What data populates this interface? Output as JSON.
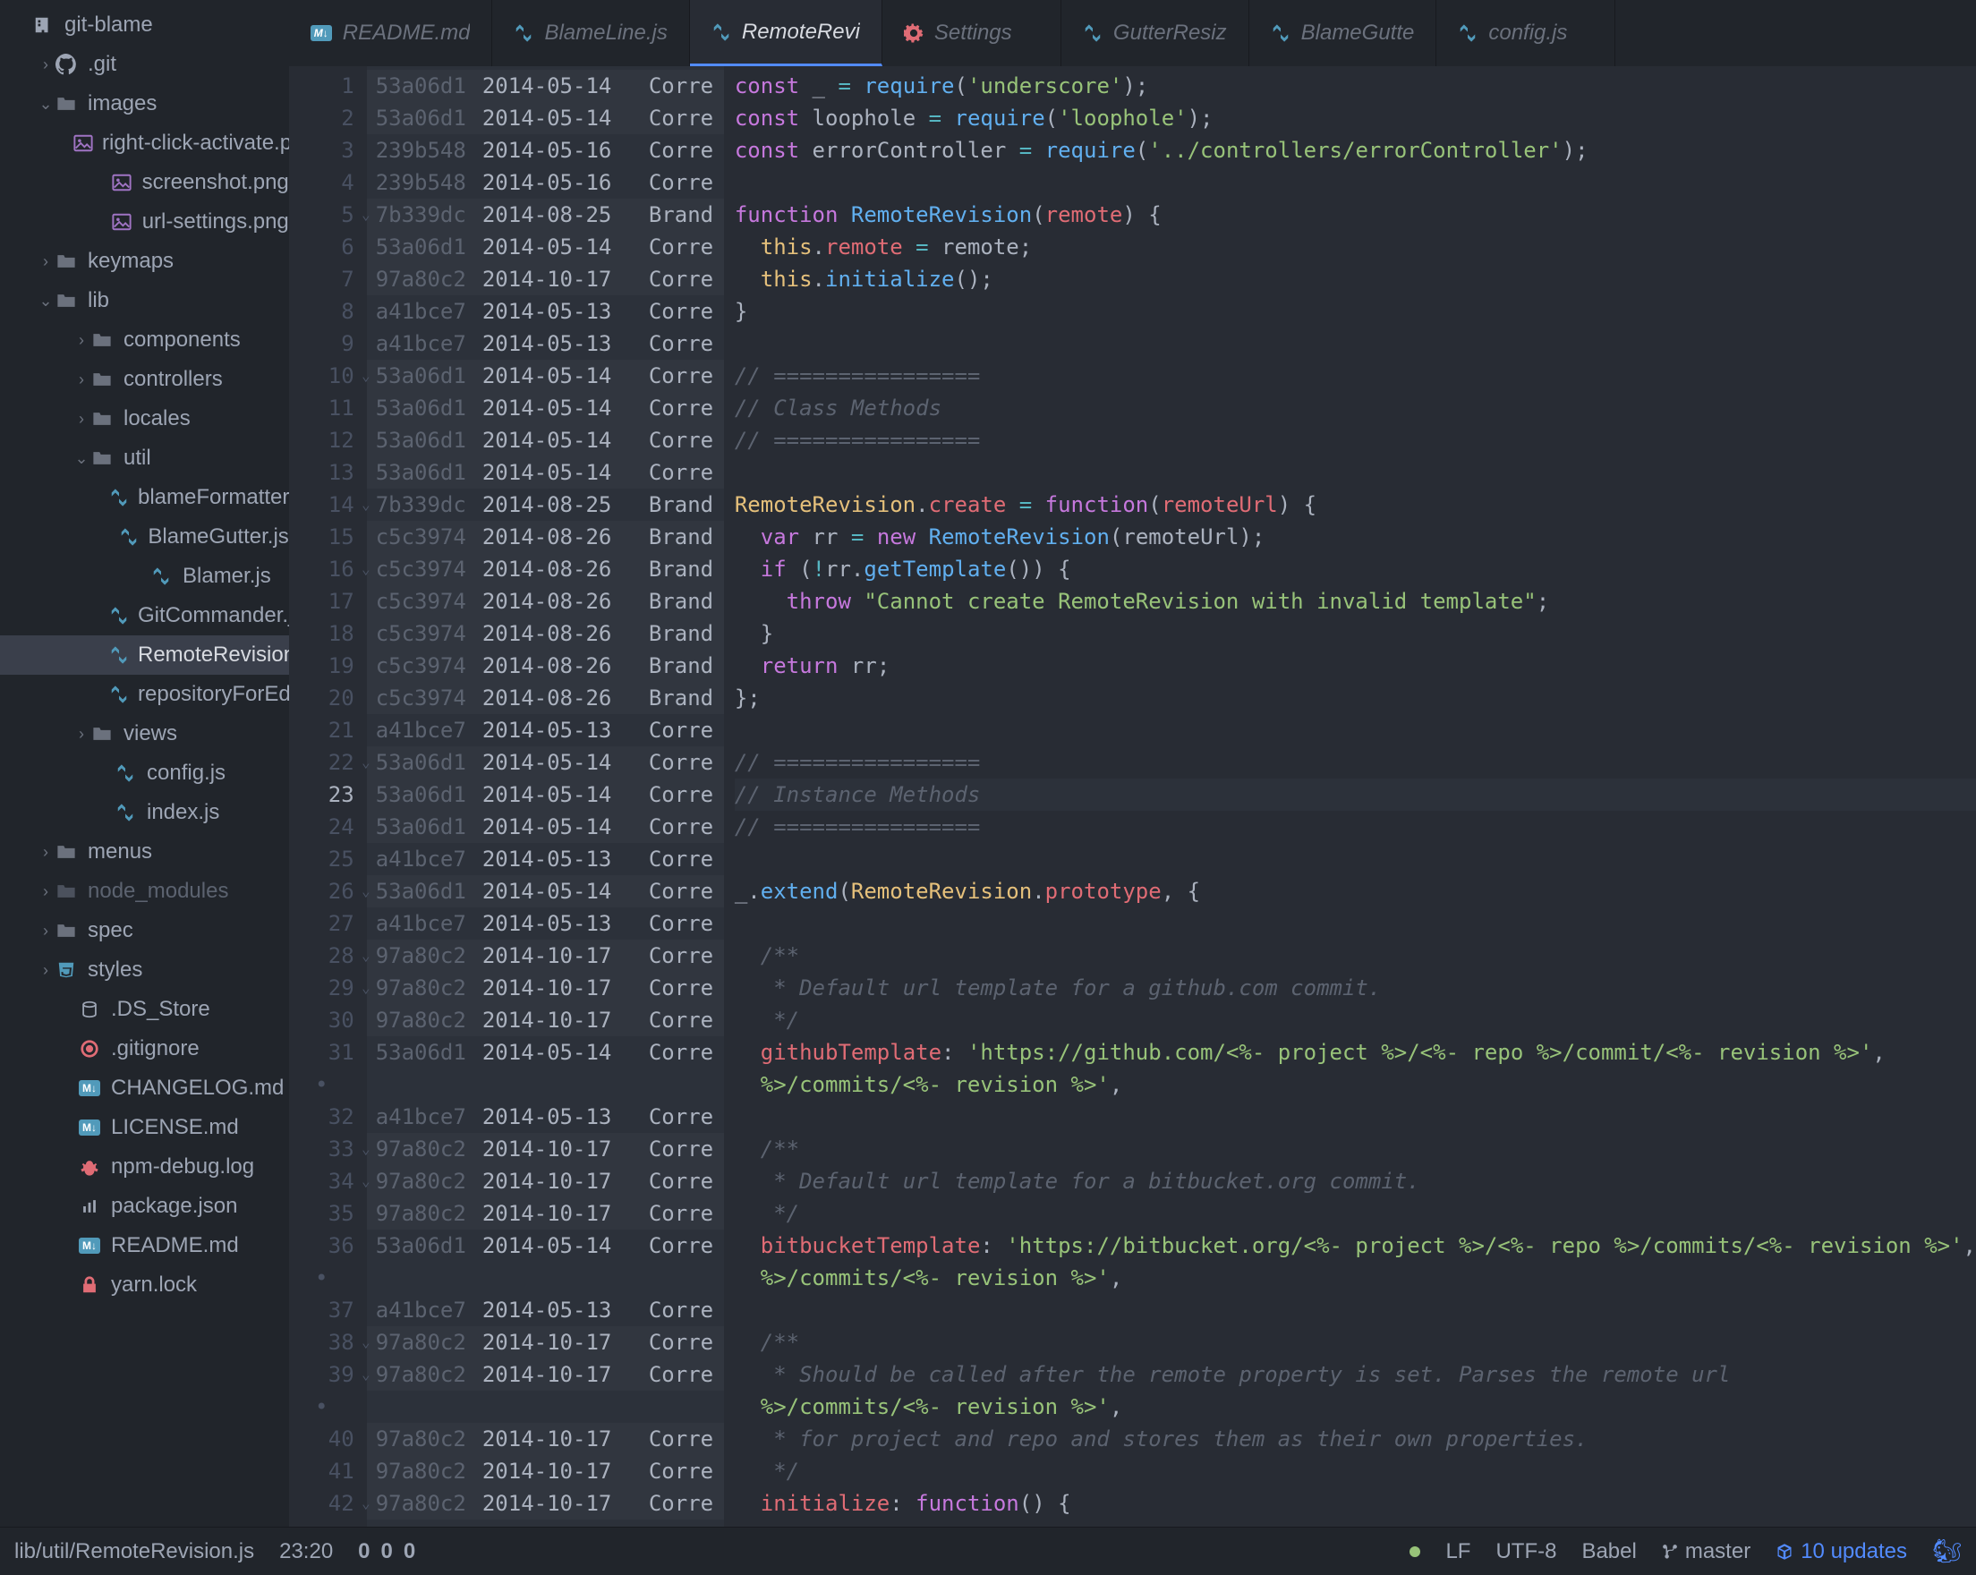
{
  "project": {
    "name": "git-blame"
  },
  "tree": [
    {
      "indent": 0,
      "chev": "",
      "iconType": "repo",
      "label": "git-blame"
    },
    {
      "indent": 1,
      "chev": "›",
      "iconType": "github",
      "label": ".git"
    },
    {
      "indent": 1,
      "chev": "⌄",
      "iconType": "folder",
      "label": "images"
    },
    {
      "indent": 2,
      "chev": "",
      "iconType": "img",
      "label": "right-click-activate.png",
      "leaf": true
    },
    {
      "indent": 2,
      "chev": "",
      "iconType": "img",
      "label": "screenshot.png",
      "leaf": true
    },
    {
      "indent": 2,
      "chev": "",
      "iconType": "img",
      "label": "url-settings.png",
      "leaf": true
    },
    {
      "indent": 1,
      "chev": "›",
      "iconType": "folder",
      "label": "keymaps"
    },
    {
      "indent": 1,
      "chev": "⌄",
      "iconType": "folder",
      "label": "lib"
    },
    {
      "indent": 2,
      "chev": "›",
      "iconType": "folder",
      "label": "components"
    },
    {
      "indent": 2,
      "chev": "›",
      "iconType": "folder",
      "label": "controllers"
    },
    {
      "indent": 2,
      "chev": "›",
      "iconType": "folder",
      "label": "locales"
    },
    {
      "indent": 2,
      "chev": "⌄",
      "iconType": "folder",
      "label": "util"
    },
    {
      "indent": 3,
      "chev": "",
      "iconType": "js",
      "label": "blameFormatter.js",
      "leaf": true
    },
    {
      "indent": 3,
      "chev": "",
      "iconType": "js",
      "label": "BlameGutter.js",
      "leaf": true
    },
    {
      "indent": 3,
      "chev": "",
      "iconType": "js",
      "label": "Blamer.js",
      "leaf": true
    },
    {
      "indent": 3,
      "chev": "",
      "iconType": "js",
      "label": "GitCommander.js",
      "leaf": true
    },
    {
      "indent": 3,
      "chev": "",
      "iconType": "js",
      "label": "RemoteRevision.js",
      "leaf": true,
      "selected": true
    },
    {
      "indent": 3,
      "chev": "",
      "iconType": "js",
      "label": "repositoryForEditorPath.js",
      "leaf": true
    },
    {
      "indent": 2,
      "chev": "›",
      "iconType": "folder",
      "label": "views"
    },
    {
      "indent": 2,
      "chev": "",
      "iconType": "js",
      "label": "config.js",
      "leaf": true
    },
    {
      "indent": 2,
      "chev": "",
      "iconType": "js",
      "label": "index.js",
      "leaf": true
    },
    {
      "indent": 1,
      "chev": "›",
      "iconType": "folder",
      "label": "menus"
    },
    {
      "indent": 1,
      "chev": "›",
      "iconType": "folder-dim",
      "label": "node_modules"
    },
    {
      "indent": 1,
      "chev": "›",
      "iconType": "folder",
      "label": "spec"
    },
    {
      "indent": 1,
      "chev": "›",
      "iconType": "css",
      "label": "styles"
    },
    {
      "indent": 1,
      "chev": "",
      "iconType": "data",
      "label": ".DS_Store",
      "leaf": true
    },
    {
      "indent": 1,
      "chev": "",
      "iconType": "git",
      "label": ".gitignore",
      "leaf": true
    },
    {
      "indent": 1,
      "chev": "",
      "iconType": "md",
      "label": "CHANGELOG.md",
      "leaf": true
    },
    {
      "indent": 1,
      "chev": "",
      "iconType": "md",
      "label": "LICENSE.md",
      "leaf": true
    },
    {
      "indent": 1,
      "chev": "",
      "iconType": "bug",
      "label": "npm-debug.log",
      "leaf": true
    },
    {
      "indent": 1,
      "chev": "",
      "iconType": "npm",
      "label": "package.json",
      "leaf": true
    },
    {
      "indent": 1,
      "chev": "",
      "iconType": "md",
      "label": "README.md",
      "leaf": true
    },
    {
      "indent": 1,
      "chev": "",
      "iconType": "lock",
      "label": "yarn.lock",
      "leaf": true
    }
  ],
  "tabs": [
    {
      "icon": "md",
      "label": "README.md"
    },
    {
      "icon": "js",
      "label": "BlameLine.js"
    },
    {
      "icon": "js",
      "label": "RemoteRevi",
      "active": true
    },
    {
      "icon": "gear",
      "label": "Settings"
    },
    {
      "icon": "js",
      "label": "GutterResiz"
    },
    {
      "icon": "js",
      "label": "BlameGutte"
    },
    {
      "icon": "js",
      "label": "config.js"
    }
  ],
  "blame": [
    {
      "n": 1,
      "hash": "53a06d1",
      "date": "2014-05-14",
      "auth": "Corre",
      "alt": true
    },
    {
      "n": 2,
      "hash": "53a06d1",
      "date": "2014-05-14",
      "auth": "Corre",
      "alt": true
    },
    {
      "n": 3,
      "hash": "239b548",
      "date": "2014-05-16",
      "auth": "Corre"
    },
    {
      "n": 4,
      "hash": "239b548",
      "date": "2014-05-16",
      "auth": "Corre"
    },
    {
      "n": 5,
      "hash": "7b339dc",
      "date": "2014-08-25",
      "auth": "Brand",
      "fold": true,
      "alt": true
    },
    {
      "n": 6,
      "hash": "53a06d1",
      "date": "2014-05-14",
      "auth": "Corre",
      "alt": true
    },
    {
      "n": 7,
      "hash": "97a80c2",
      "date": "2014-10-17",
      "auth": "Corre",
      "alt": true
    },
    {
      "n": 8,
      "hash": "a41bce7",
      "date": "2014-05-13",
      "auth": "Corre"
    },
    {
      "n": 9,
      "hash": "a41bce7",
      "date": "2014-05-13",
      "auth": "Corre"
    },
    {
      "n": 10,
      "hash": "53a06d1",
      "date": "2014-05-14",
      "auth": "Corre",
      "fold": true,
      "alt": true
    },
    {
      "n": 11,
      "hash": "53a06d1",
      "date": "2014-05-14",
      "auth": "Corre",
      "alt": true
    },
    {
      "n": 12,
      "hash": "53a06d1",
      "date": "2014-05-14",
      "auth": "Corre",
      "alt": true
    },
    {
      "n": 13,
      "hash": "53a06d1",
      "date": "2014-05-14",
      "auth": "Corre",
      "alt": true
    },
    {
      "n": 14,
      "hash": "7b339dc",
      "date": "2014-08-25",
      "auth": "Brand",
      "fold": true
    },
    {
      "n": 15,
      "hash": "c5c3974",
      "date": "2014-08-26",
      "auth": "Brand",
      "alt": true
    },
    {
      "n": 16,
      "hash": "c5c3974",
      "date": "2014-08-26",
      "auth": "Brand",
      "fold": true,
      "alt": true
    },
    {
      "n": 17,
      "hash": "c5c3974",
      "date": "2014-08-26",
      "auth": "Brand",
      "alt": true
    },
    {
      "n": 18,
      "hash": "c5c3974",
      "date": "2014-08-26",
      "auth": "Brand",
      "alt": true
    },
    {
      "n": 19,
      "hash": "c5c3974",
      "date": "2014-08-26",
      "auth": "Brand",
      "alt": true
    },
    {
      "n": 20,
      "hash": "c5c3974",
      "date": "2014-08-26",
      "auth": "Brand",
      "alt": true
    },
    {
      "n": 21,
      "hash": "a41bce7",
      "date": "2014-05-13",
      "auth": "Corre"
    },
    {
      "n": 22,
      "hash": "53a06d1",
      "date": "2014-05-14",
      "auth": "Corre",
      "fold": true,
      "alt": true
    },
    {
      "n": 23,
      "hash": "53a06d1",
      "date": "2014-05-14",
      "auth": "Corre",
      "alt": true,
      "current": true
    },
    {
      "n": 24,
      "hash": "53a06d1",
      "date": "2014-05-14",
      "auth": "Corre",
      "alt": true
    },
    {
      "n": 25,
      "hash": "a41bce7",
      "date": "2014-05-13",
      "auth": "Corre"
    },
    {
      "n": 26,
      "hash": "53a06d1",
      "date": "2014-05-14",
      "auth": "Corre",
      "fold": true,
      "alt": true
    },
    {
      "n": 27,
      "hash": "a41bce7",
      "date": "2014-05-13",
      "auth": "Corre"
    },
    {
      "n": 28,
      "hash": "97a80c2",
      "date": "2014-10-17",
      "auth": "Corre",
      "fold": true,
      "alt": true
    },
    {
      "n": 29,
      "hash": "97a80c2",
      "date": "2014-10-17",
      "auth": "Corre",
      "fold": true,
      "alt": true
    },
    {
      "n": 30,
      "hash": "97a80c2",
      "date": "2014-10-17",
      "auth": "Corre",
      "alt": true
    },
    {
      "n": 31,
      "hash": "53a06d1",
      "date": "2014-05-14",
      "auth": "Corre"
    },
    {
      "n": "dot"
    },
    {
      "n": 32,
      "hash": "a41bce7",
      "date": "2014-05-13",
      "auth": "Corre"
    },
    {
      "n": 33,
      "hash": "97a80c2",
      "date": "2014-10-17",
      "auth": "Corre",
      "fold": true,
      "alt": true
    },
    {
      "n": 34,
      "hash": "97a80c2",
      "date": "2014-10-17",
      "auth": "Corre",
      "fold": true,
      "alt": true
    },
    {
      "n": 35,
      "hash": "97a80c2",
      "date": "2014-10-17",
      "auth": "Corre",
      "alt": true
    },
    {
      "n": 36,
      "hash": "53a06d1",
      "date": "2014-05-14",
      "auth": "Corre"
    },
    {
      "n": "dot"
    },
    {
      "n": 37,
      "hash": "a41bce7",
      "date": "2014-05-13",
      "auth": "Corre"
    },
    {
      "n": 38,
      "hash": "97a80c2",
      "date": "2014-10-17",
      "auth": "Corre",
      "fold": true,
      "alt": true
    },
    {
      "n": 39,
      "hash": "97a80c2",
      "date": "2014-10-17",
      "auth": "Corre",
      "fold": true,
      "alt": true
    },
    {
      "n": "dot"
    },
    {
      "n": 40,
      "hash": "97a80c2",
      "date": "2014-10-17",
      "auth": "Corre",
      "alt": true
    },
    {
      "n": 41,
      "hash": "97a80c2",
      "date": "2014-10-17",
      "auth": "Corre",
      "alt": true
    },
    {
      "n": 42,
      "hash": "97a80c2",
      "date": "2014-10-17",
      "auth": "Corre",
      "fold": true,
      "alt": true
    }
  ],
  "code": [
    [
      [
        "kw",
        "const"
      ],
      [
        "def",
        " _ "
      ],
      [
        "op",
        "="
      ],
      [
        "def",
        " "
      ],
      [
        "fn",
        "require"
      ],
      [
        "punc",
        "("
      ],
      [
        "str",
        "'underscore'"
      ],
      [
        "punc",
        ");"
      ]
    ],
    [
      [
        "kw",
        "const"
      ],
      [
        "def",
        " loophole "
      ],
      [
        "op",
        "="
      ],
      [
        "def",
        " "
      ],
      [
        "fn",
        "require"
      ],
      [
        "punc",
        "("
      ],
      [
        "str",
        "'loophole'"
      ],
      [
        "punc",
        ");"
      ]
    ],
    [
      [
        "kw",
        "const"
      ],
      [
        "def",
        " errorController "
      ],
      [
        "op",
        "="
      ],
      [
        "def",
        " "
      ],
      [
        "fn",
        "require"
      ],
      [
        "punc",
        "("
      ],
      [
        "str",
        "'../controllers/errorController'"
      ],
      [
        "punc",
        ");"
      ]
    ],
    [
      [
        "def",
        ""
      ]
    ],
    [
      [
        "kw",
        "function"
      ],
      [
        "def",
        " "
      ],
      [
        "fn",
        "RemoteRevision"
      ],
      [
        "punc",
        "("
      ],
      [
        "var",
        "remote"
      ],
      [
        "punc",
        ")"
      ],
      [
        "def",
        " "
      ],
      [
        "punc",
        "{"
      ]
    ],
    [
      [
        "def",
        "  "
      ],
      [
        "this",
        "this"
      ],
      [
        "punc",
        "."
      ],
      [
        "var",
        "remote"
      ],
      [
        "def",
        " "
      ],
      [
        "op",
        "="
      ],
      [
        "def",
        " remote"
      ],
      [
        "punc",
        ";"
      ]
    ],
    [
      [
        "def",
        "  "
      ],
      [
        "this",
        "this"
      ],
      [
        "punc",
        "."
      ],
      [
        "fn",
        "initialize"
      ],
      [
        "punc",
        "();"
      ]
    ],
    [
      [
        "punc",
        "}"
      ]
    ],
    [
      [
        "def",
        ""
      ]
    ],
    [
      [
        "comm",
        "// ================"
      ]
    ],
    [
      [
        "comm",
        "// Class Methods"
      ]
    ],
    [
      [
        "comm",
        "// ================"
      ]
    ],
    [
      [
        "def",
        ""
      ]
    ],
    [
      [
        "cls",
        "RemoteRevision"
      ],
      [
        "punc",
        "."
      ],
      [
        "var",
        "create"
      ],
      [
        "def",
        " "
      ],
      [
        "op",
        "="
      ],
      [
        "def",
        " "
      ],
      [
        "kw",
        "function"
      ],
      [
        "punc",
        "("
      ],
      [
        "var",
        "remoteUrl"
      ],
      [
        "punc",
        ")"
      ],
      [
        "def",
        " "
      ],
      [
        "punc",
        "{"
      ]
    ],
    [
      [
        "def",
        "  "
      ],
      [
        "kw",
        "var"
      ],
      [
        "def",
        " rr "
      ],
      [
        "op",
        "="
      ],
      [
        "def",
        " "
      ],
      [
        "kw",
        "new"
      ],
      [
        "def",
        " "
      ],
      [
        "fn",
        "RemoteRevision"
      ],
      [
        "punc",
        "("
      ],
      [
        "def",
        "remoteUrl"
      ],
      [
        "punc",
        ");"
      ]
    ],
    [
      [
        "def",
        "  "
      ],
      [
        "kw",
        "if"
      ],
      [
        "def",
        " "
      ],
      [
        "punc",
        "("
      ],
      [
        "op",
        "!"
      ],
      [
        "def",
        "rr"
      ],
      [
        "punc",
        "."
      ],
      [
        "fn",
        "getTemplate"
      ],
      [
        "punc",
        "())"
      ],
      [
        "def",
        " "
      ],
      [
        "punc",
        "{"
      ]
    ],
    [
      [
        "def",
        "    "
      ],
      [
        "kw",
        "throw"
      ],
      [
        "def",
        " "
      ],
      [
        "str",
        "\"Cannot create RemoteRevision with invalid template\""
      ],
      [
        "punc",
        ";"
      ]
    ],
    [
      [
        "def",
        "  "
      ],
      [
        "punc",
        "}"
      ]
    ],
    [
      [
        "def",
        "  "
      ],
      [
        "kw",
        "return"
      ],
      [
        "def",
        " rr"
      ],
      [
        "punc",
        ";"
      ]
    ],
    [
      [
        "punc",
        "};"
      ]
    ],
    [
      [
        "def",
        ""
      ]
    ],
    [
      [
        "comm",
        "// ================"
      ]
    ],
    [
      [
        "comm",
        "// Instance Methods"
      ]
    ],
    [
      [
        "comm",
        "// ================"
      ]
    ],
    [
      [
        "def",
        ""
      ]
    ],
    [
      [
        "def",
        "_"
      ],
      [
        "punc",
        "."
      ],
      [
        "fn",
        "extend"
      ],
      [
        "punc",
        "("
      ],
      [
        "cls",
        "RemoteRevision"
      ],
      [
        "punc",
        "."
      ],
      [
        "var",
        "prototype"
      ],
      [
        "punc",
        ","
      ],
      [
        "def",
        " "
      ],
      [
        "punc",
        "{"
      ]
    ],
    [
      [
        "def",
        ""
      ]
    ],
    [
      [
        "def",
        "  "
      ],
      [
        "comm",
        "/**"
      ]
    ],
    [
      [
        "def",
        "  "
      ],
      [
        "comm",
        " * Default url template for a github.com commit."
      ]
    ],
    [
      [
        "def",
        "  "
      ],
      [
        "comm",
        " */"
      ]
    ],
    [
      [
        "def",
        "  "
      ],
      [
        "prop",
        "githubTemplate"
      ],
      [
        "punc",
        ":"
      ],
      [
        "def",
        " "
      ],
      [
        "str",
        "'https://github.com/<%- project %>/<%- repo %>/commit/<%- revision %>'"
      ],
      [
        "punc",
        ","
      ]
    ],
    [
      [
        "def",
        ""
      ]
    ],
    [
      [
        "def",
        "  "
      ],
      [
        "comm",
        "/**"
      ]
    ],
    [
      [
        "def",
        "  "
      ],
      [
        "comm",
        " * Default url template for a bitbucket.org commit."
      ]
    ],
    [
      [
        "def",
        "  "
      ],
      [
        "comm",
        " */"
      ]
    ],
    [
      [
        "def",
        "  "
      ],
      [
        "prop",
        "bitbucketTemplate"
      ],
      [
        "punc",
        ":"
      ],
      [
        "def",
        " "
      ],
      [
        "str",
        "'https://bitbucket.org/<%- project %>/<%- repo %>/commits/<%- revision %>'"
      ],
      [
        "punc",
        ","
      ]
    ],
    [
      [
        "def",
        ""
      ]
    ],
    [
      [
        "def",
        "  "
      ],
      [
        "comm",
        "/**"
      ]
    ],
    [
      [
        "def",
        "  "
      ],
      [
        "comm",
        " * Should be called after the remote property is set. Parses the remote url"
      ]
    ],
    [
      [
        "def",
        "  "
      ],
      [
        "comm",
        " * for project and repo and stores them as their own properties."
      ]
    ],
    [
      [
        "def",
        "  "
      ],
      [
        "comm",
        " */"
      ]
    ],
    [
      [
        "def",
        "  "
      ],
      [
        "prop",
        "initialize"
      ],
      [
        "punc",
        ":"
      ],
      [
        "def",
        " "
      ],
      [
        "kw",
        "function"
      ],
      [
        "punc",
        "()"
      ],
      [
        "def",
        " "
      ],
      [
        "punc",
        "{"
      ]
    ]
  ],
  "status": {
    "path": "lib/util/RemoteRevision.js",
    "cursor": "23:20",
    "counts": [
      "0",
      "0",
      "0"
    ],
    "lf": "LF",
    "encoding": "UTF-8",
    "grammar": "Babel",
    "branch": "master",
    "updates": "10 updates"
  }
}
